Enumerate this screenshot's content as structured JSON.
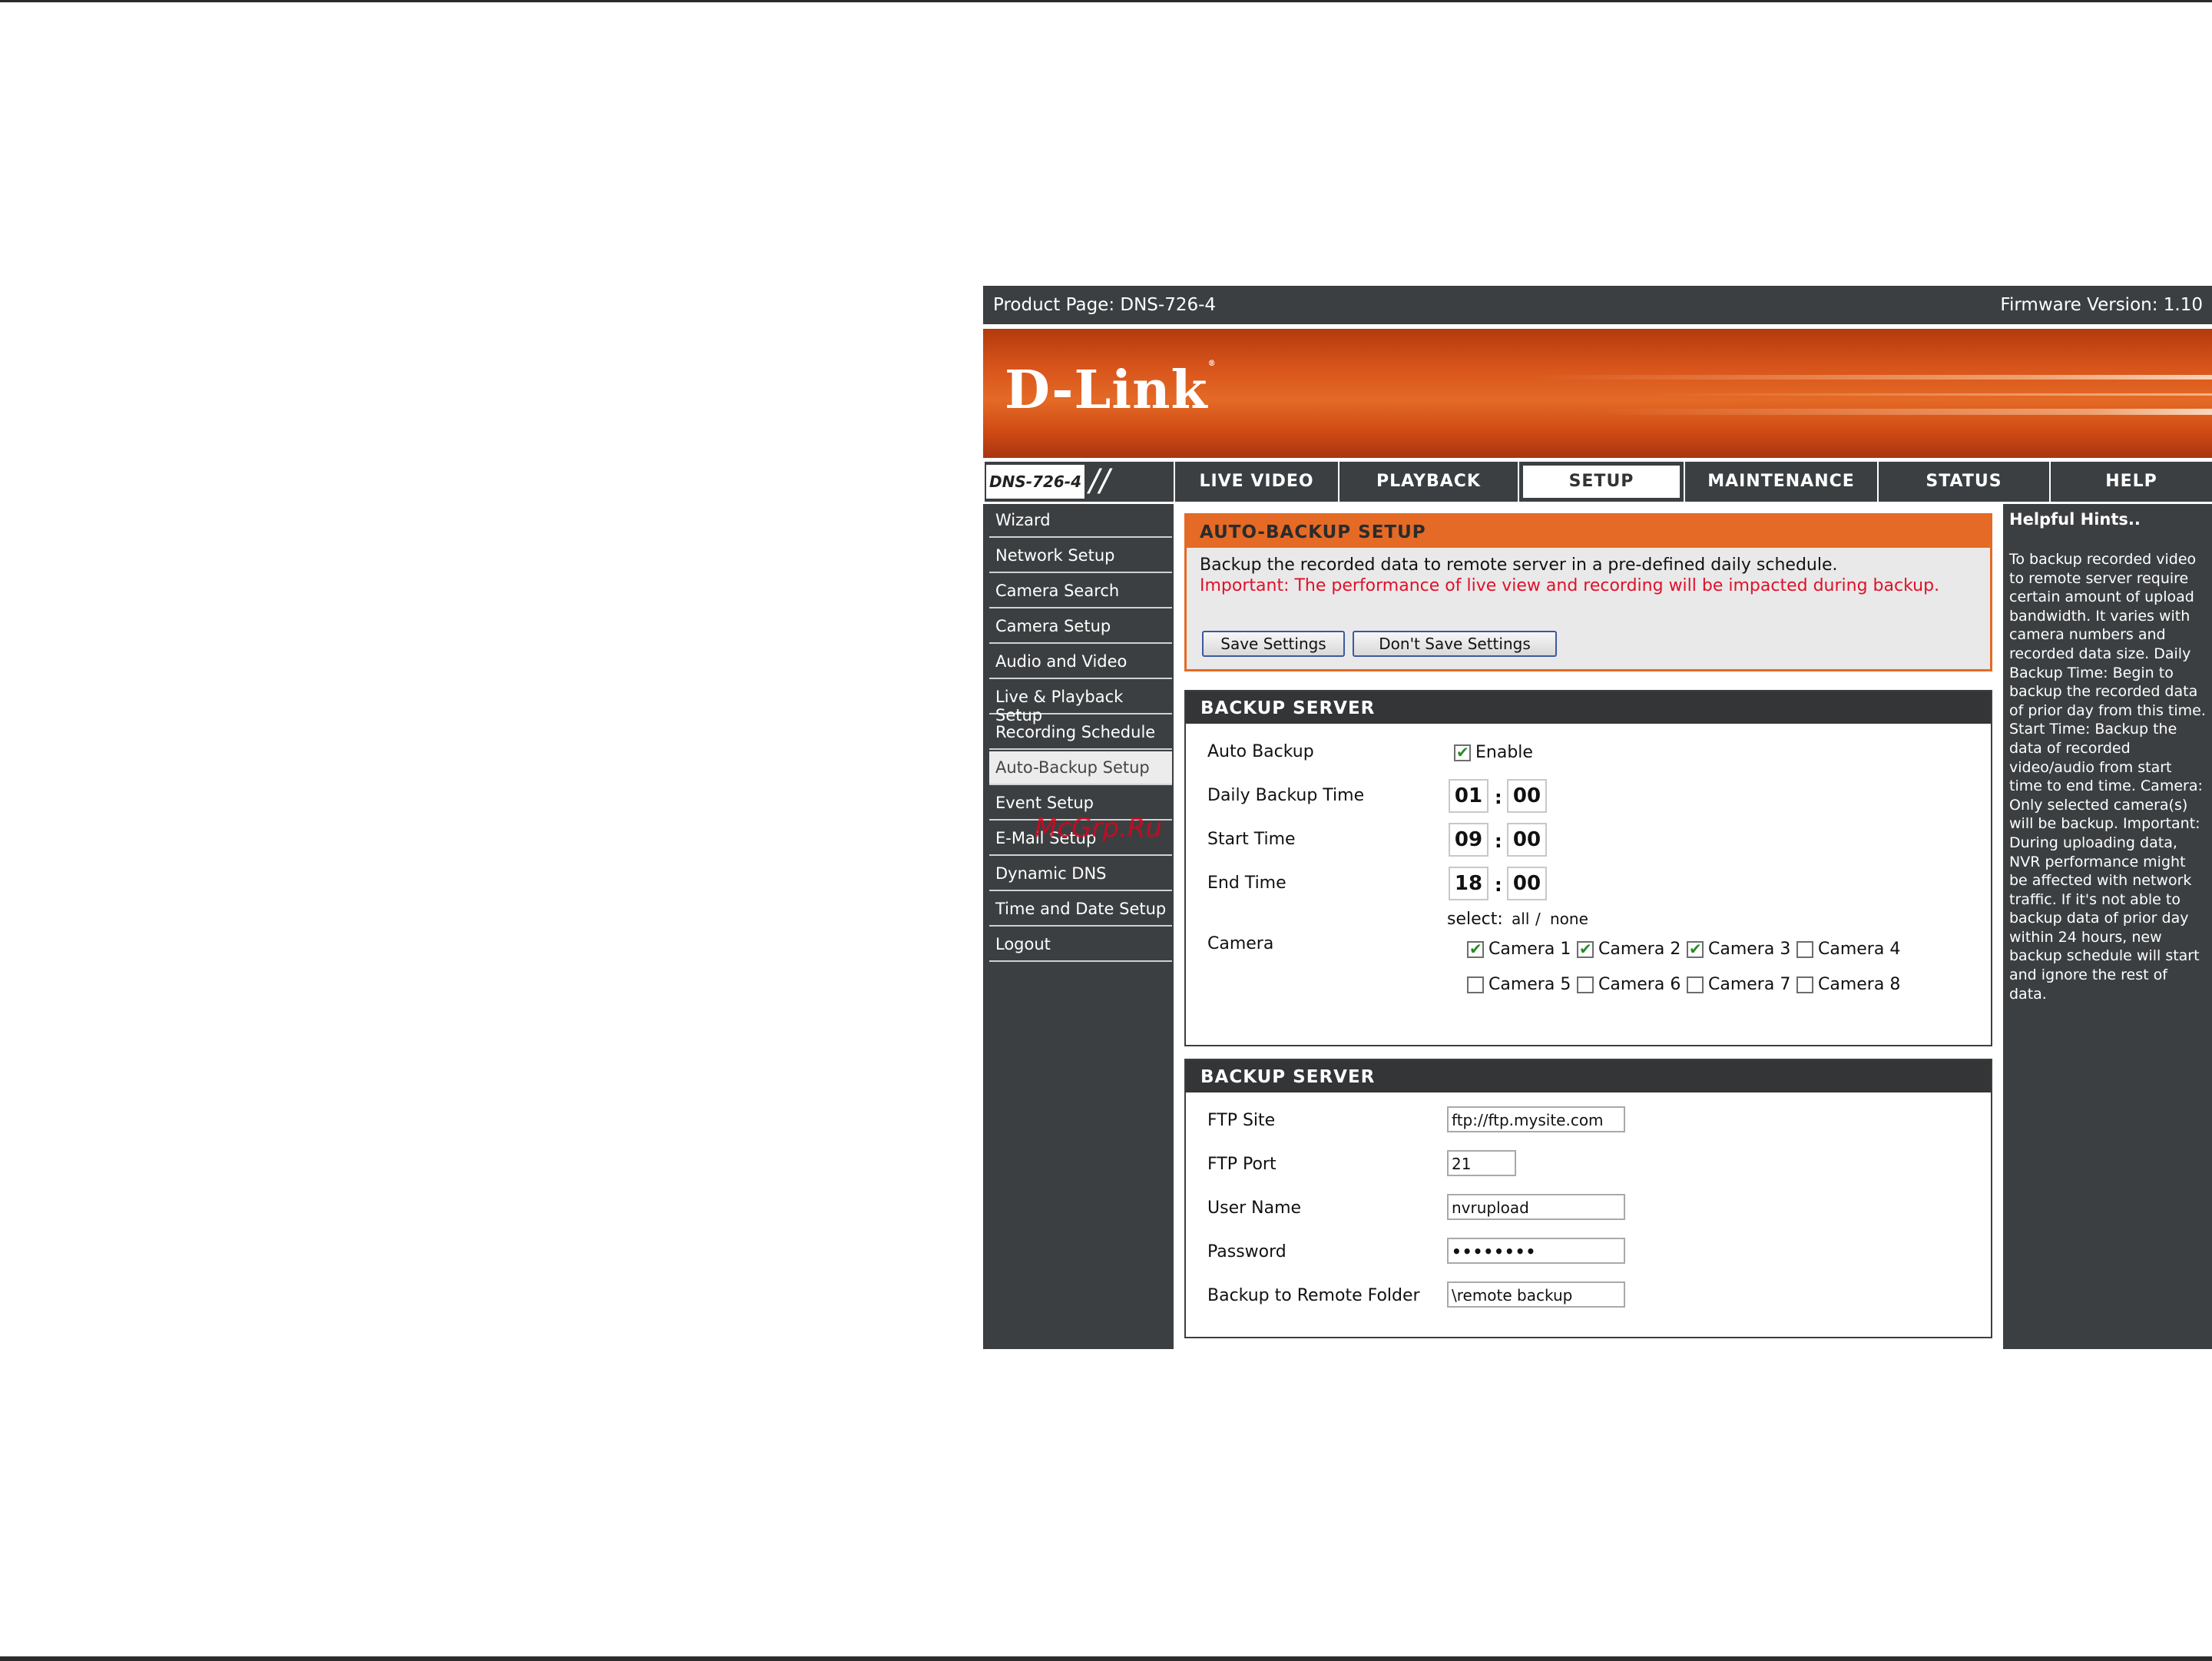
{
  "topbar": {
    "product": "Product Page: DNS-726-4",
    "firmware": "Firmware Version: 1.10"
  },
  "logo": "D-Link",
  "model_badge": "DNS-726-4",
  "tabs": [
    "LIVE VIDEO",
    "PLAYBACK",
    "SETUP",
    "MAINTENANCE",
    "STATUS",
    "HELP"
  ],
  "active_tab": "SETUP",
  "sidebar": {
    "items": [
      "Wizard",
      "Network Setup",
      "Camera Search",
      "Camera Setup",
      "Audio and Video",
      "Live & Playback Setup",
      "Recording Schedule",
      "Auto-Backup Setup",
      "Event Setup",
      "E-Mail Setup",
      "Dynamic DNS",
      "Time and Date Setup",
      "Logout"
    ],
    "active": "Auto-Backup Setup"
  },
  "autobackup": {
    "title": "AUTO-BACKUP SETUP",
    "description": "Backup the recorded data to remote server in a pre-defined daily schedule.",
    "important": "Important: The performance of live view and recording will be impacted during backup.",
    "save_label": "Save Settings",
    "dont_save_label": "Don't Save Settings"
  },
  "schedule": {
    "title": "BACKUP SERVER",
    "auto_backup_label": "Auto Backup",
    "enable_label": "Enable",
    "enable_checked": true,
    "daily_label": "Daily Backup Time",
    "daily_h": "01",
    "daily_m": "00",
    "start_label": "Start Time",
    "start_h": "09",
    "start_m": "00",
    "end_label": "End Time",
    "end_h": "18",
    "end_m": "00",
    "colon": ":",
    "camera_label": "Camera",
    "select_label": "select:",
    "select_all": "all",
    "select_sep": "/",
    "select_none": "none",
    "cameras": [
      {
        "label": "Camera 1",
        "checked": true
      },
      {
        "label": "Camera 2",
        "checked": true
      },
      {
        "label": "Camera 3",
        "checked": true
      },
      {
        "label": "Camera 4",
        "checked": false
      },
      {
        "label": "Camera 5",
        "checked": false
      },
      {
        "label": "Camera 6",
        "checked": false
      },
      {
        "label": "Camera 7",
        "checked": false
      },
      {
        "label": "Camera 8",
        "checked": false
      }
    ]
  },
  "server": {
    "title": "BACKUP SERVER",
    "ftp_site_label": "FTP Site",
    "ftp_site": "ftp://ftp.mysite.com",
    "ftp_port_label": "FTP Port",
    "ftp_port": "21",
    "user_label": "User Name",
    "user": "nvrupload",
    "password_label": "Password",
    "password": "••••••••",
    "folder_label": "Backup to Remote Folder",
    "folder": "\\remote backup"
  },
  "hints": {
    "title": "Helpful Hints..",
    "body": "To backup recorded video to remote server require certain amount of upload bandwidth. It varies with camera numbers and recorded data size. Daily Backup Time: Begin to backup the recorded data of prior day from this time. Start Time: Backup the data of recorded video/audio from start time to end time. Camera: Only selected camera(s) will be backup. Important: During uploading data, NVR performance might be affected with network traffic. If it's not able to backup data of prior day within 24 hours, new backup schedule will start and ignore the rest of data."
  },
  "watermark": "McGrp.Ru",
  "colors": {
    "orange": "#e46a26",
    "dark": "#3c3f41",
    "important_red": "#e0102a"
  }
}
